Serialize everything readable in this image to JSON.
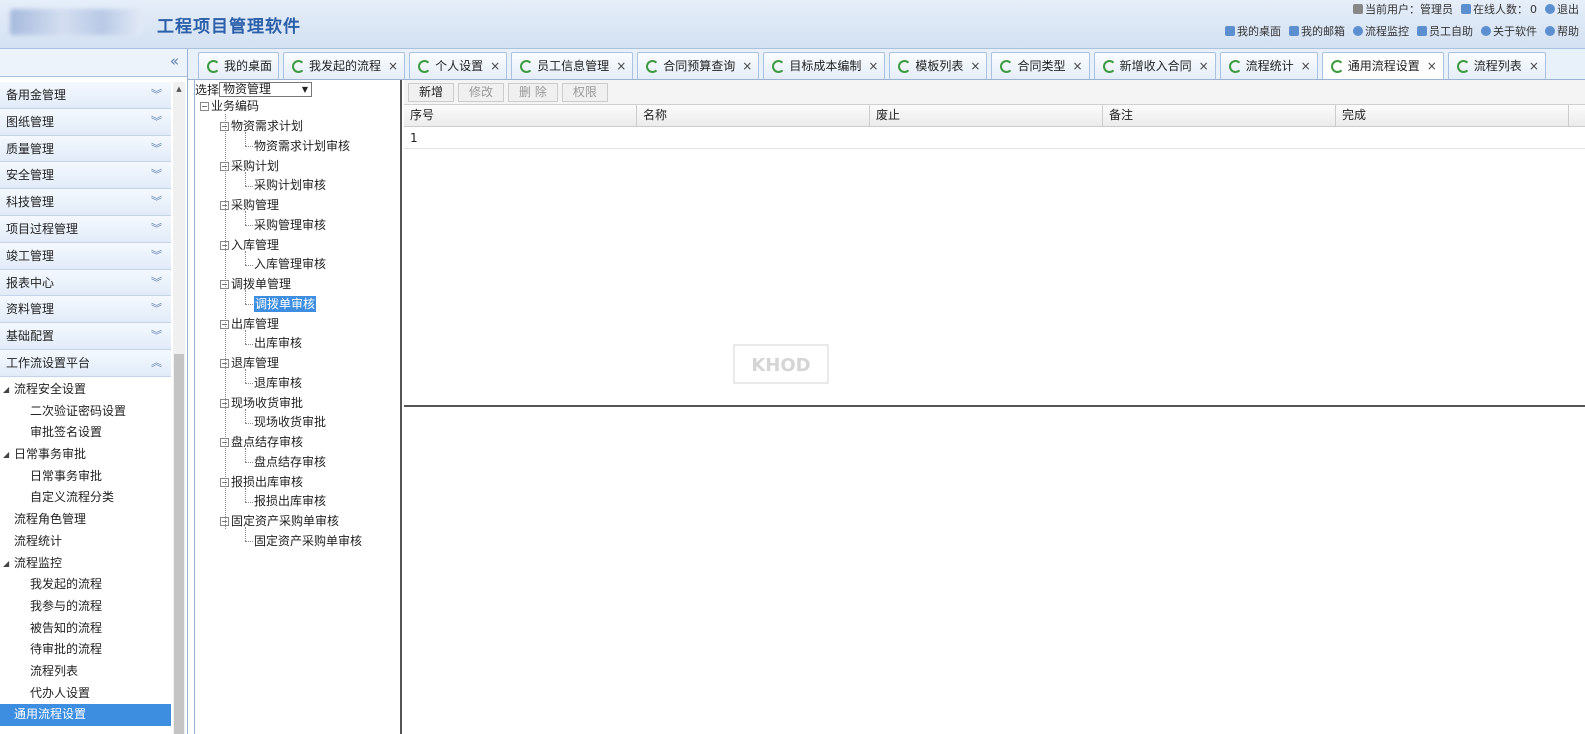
{
  "app": {
    "title": "工程项目管理软件"
  },
  "header": {
    "current_user_label": "当前用户：管理员",
    "online_label": "在线人数：",
    "online_count": "0",
    "logout": "退出",
    "links": [
      "我的桌面",
      "我的邮箱",
      "流程监控",
      "员工自助",
      "关于软件",
      "帮助"
    ]
  },
  "sidebar": {
    "collapse": "«",
    "sections": [
      "备用金管理",
      "图纸管理",
      "质量管理",
      "安全管理",
      "科技管理",
      "项目过程管理",
      "竣工管理",
      "报表中心",
      "资料管理",
      "基础配置",
      "工作流设置平台"
    ],
    "tree": [
      {
        "label": "流程安全设置",
        "level": 1,
        "arrow": "◢"
      },
      {
        "label": "二次验证密码设置",
        "level": 2
      },
      {
        "label": "审批签名设置",
        "level": 2
      },
      {
        "label": "日常事务审批",
        "level": 1,
        "arrow": "◢"
      },
      {
        "label": "日常事务审批",
        "level": 2
      },
      {
        "label": "自定义流程分类",
        "level": 2
      },
      {
        "label": "流程角色管理",
        "level": 1
      },
      {
        "label": "流程统计",
        "level": 1
      },
      {
        "label": "流程监控",
        "level": 1,
        "arrow": "◢"
      },
      {
        "label": "我发起的流程",
        "level": 2
      },
      {
        "label": "我参与的流程",
        "level": 2
      },
      {
        "label": "被告知的流程",
        "level": 2
      },
      {
        "label": "待审批的流程",
        "level": 2
      },
      {
        "label": "流程列表",
        "level": 2
      },
      {
        "label": "代办人设置",
        "level": 2
      },
      {
        "label": "通用流程设置",
        "level": 1,
        "selected": true
      }
    ]
  },
  "tabs": [
    {
      "label": "我的桌面",
      "closable": false
    },
    {
      "label": "我发起的流程",
      "closable": true
    },
    {
      "label": "个人设置",
      "closable": true
    },
    {
      "label": "员工信息管理",
      "closable": true
    },
    {
      "label": "合同预算查询",
      "closable": true
    },
    {
      "label": "目标成本编制",
      "closable": true
    },
    {
      "label": "模板列表",
      "closable": true
    },
    {
      "label": "合同类型",
      "closable": true
    },
    {
      "label": "新增收入合同",
      "closable": true
    },
    {
      "label": "流程统计",
      "closable": true
    },
    {
      "label": "通用流程设置",
      "closable": true,
      "active": true
    },
    {
      "label": "流程列表",
      "closable": true
    }
  ],
  "treepane": {
    "select_label": "选择",
    "select_value": "物资管理",
    "root": "业务编码",
    "groups": [
      {
        "label": "物资需求计划",
        "child": "物资需求计划审核"
      },
      {
        "label": "采购计划",
        "child": "采购计划审核"
      },
      {
        "label": "采购管理",
        "child": "采购管理审核"
      },
      {
        "label": "入库管理",
        "child": "入库管理审核"
      },
      {
        "label": "调拨单管理",
        "child": "调拨单审核",
        "selected": true
      },
      {
        "label": "出库管理",
        "child": "出库审核"
      },
      {
        "label": "退库管理",
        "child": "退库审核"
      },
      {
        "label": "现场收货审批",
        "child": "现场收货审批"
      },
      {
        "label": "盘点结存审核",
        "child": "盘点结存审核"
      },
      {
        "label": "报损出库审核",
        "child": "报损出库审核"
      },
      {
        "label": "固定资产采购单审核",
        "child": "固定资产采购单审核"
      }
    ]
  },
  "toolbar": {
    "add": "新增",
    "edit": "修改",
    "delete": "删 除",
    "perm": "权限"
  },
  "grid": {
    "headers": [
      "序号",
      "名称",
      "废止",
      "备注",
      "完成"
    ],
    "rows": [
      [
        "1",
        "",
        "",
        "",
        ""
      ]
    ]
  },
  "watermark": {
    "text": "KHOD"
  },
  "colors": {
    "accent": "#3d8ee0",
    "header_bg": "#d3e1f2",
    "title": "#2b5fa9"
  }
}
